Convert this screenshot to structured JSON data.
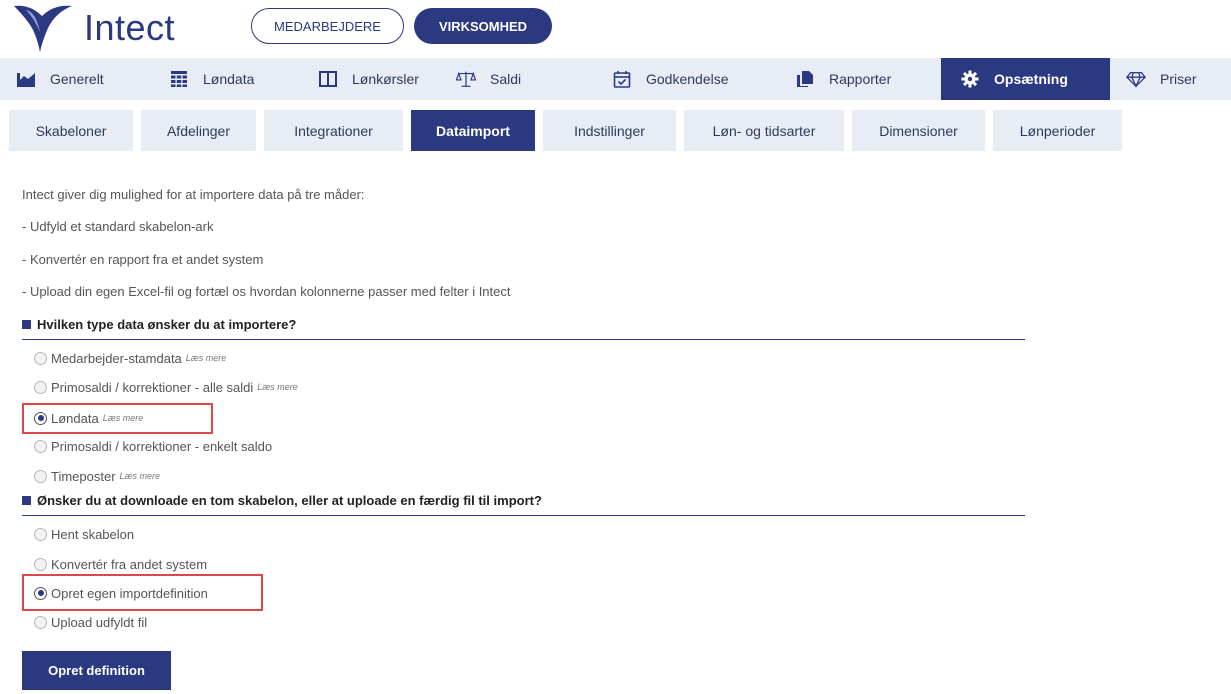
{
  "brand": {
    "name": "Intect"
  },
  "header": {
    "employees_label": "MEDARBEJDERE",
    "company_label": "VIRKSOMHED"
  },
  "main_tabs": [
    {
      "label": "Generelt",
      "icon": "bar-chart-icon"
    },
    {
      "label": "Løndata",
      "icon": "grid-table-icon"
    },
    {
      "label": "Lønkørsler",
      "icon": "columns-icon"
    },
    {
      "label": "Saldi",
      "icon": "scale-icon"
    },
    {
      "label": "Godkendelse",
      "icon": "calendar-check-icon"
    },
    {
      "label": "Rapporter",
      "icon": "files-icon"
    },
    {
      "label": "Opsætning",
      "icon": "gear-icon",
      "active": true
    },
    {
      "label": "Priser",
      "icon": "diamond-icon"
    }
  ],
  "sub_tabs": [
    {
      "label": "Skabeloner"
    },
    {
      "label": "Afdelinger"
    },
    {
      "label": "Integrationer"
    },
    {
      "label": "Dataimport",
      "active": true
    },
    {
      "label": "Indstillinger"
    },
    {
      "label": "Løn- og tidsarter"
    },
    {
      "label": "Dimensioner"
    },
    {
      "label": "Lønperioder"
    }
  ],
  "intro": [
    "Intect giver dig mulighed for at importere data på tre måder:",
    "- Udfyld et standard skabelon-ark",
    "- Konvertér en rapport fra et andet system",
    "- Upload din egen Excel-fil og fortæl os hvordan kolonnerne passer med felter i Intect"
  ],
  "section1": {
    "title": "Hvilken type data ønsker du at importere?",
    "options": [
      {
        "label": "Medarbejder-stamdata",
        "more": "Læs mere",
        "checked": false
      },
      {
        "label": "Primosaldi / korrektioner - alle saldi",
        "more": "Læs mere",
        "checked": false
      },
      {
        "label": "Løndata",
        "more": "Læs mere",
        "checked": true
      },
      {
        "label": "Primosaldi / korrektioner - enkelt saldo",
        "more": "",
        "checked": false
      },
      {
        "label": "Timeposter",
        "more": "Læs mere",
        "checked": false
      }
    ]
  },
  "section2": {
    "title": "Ønsker du at downloade en tom skabelon, eller at uploade en færdig fil til import?",
    "options": [
      {
        "label": "Hent skabelon",
        "checked": false
      },
      {
        "label": "Konvertér fra andet system",
        "checked": false
      },
      {
        "label": "Opret egen importdefinition",
        "checked": true
      },
      {
        "label": "Upload udfyldt fil",
        "checked": false
      }
    ]
  },
  "action": {
    "label": "Opret definition"
  },
  "colors": {
    "primary": "#2b3a80",
    "tab_bg": "#e8ecf5",
    "highlight": "#e0454a"
  }
}
